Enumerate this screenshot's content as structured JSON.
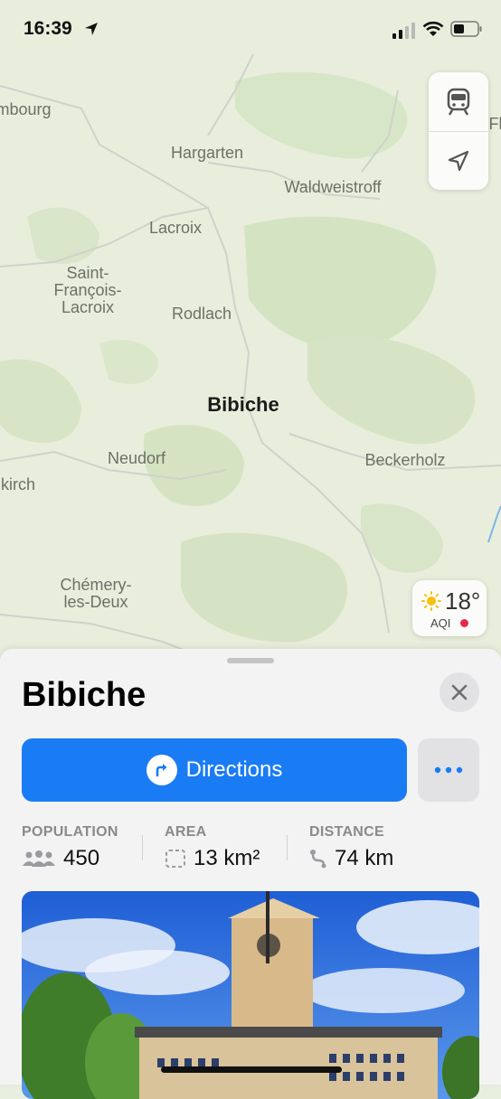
{
  "status": {
    "time": "16:39"
  },
  "map": {
    "places": [
      {
        "name": "mbourg"
      },
      {
        "name": "Hargarten"
      },
      {
        "name": "Waldweistroff"
      },
      {
        "name": "Lacroix"
      },
      {
        "name": "Saint-\nFrançois-\nLacroix"
      },
      {
        "name": "Rodlach"
      },
      {
        "name": "Bibiche"
      },
      {
        "name": "Neudorf"
      },
      {
        "name": "Beckerholz"
      },
      {
        "name": "kirch"
      },
      {
        "name": "Chémery-\nles-Deux"
      },
      {
        "name": "Fl"
      }
    ],
    "weather": {
      "temp": "18°",
      "aqi_label": "AQI",
      "aqi_color": "#e8294a"
    },
    "controls": [
      {
        "icon": "transit-icon"
      },
      {
        "icon": "location-arrow-icon"
      }
    ]
  },
  "sheet": {
    "title": "Bibiche",
    "directions_label": "Directions",
    "stats": [
      {
        "label": "POPULATION",
        "value": "450",
        "icon": "people-icon"
      },
      {
        "label": "AREA",
        "value": "13 km²",
        "icon": "area-icon"
      },
      {
        "label": "DISTANCE",
        "value": "74 km",
        "icon": "route-icon"
      }
    ],
    "accent_color": "#1a7cf5"
  }
}
